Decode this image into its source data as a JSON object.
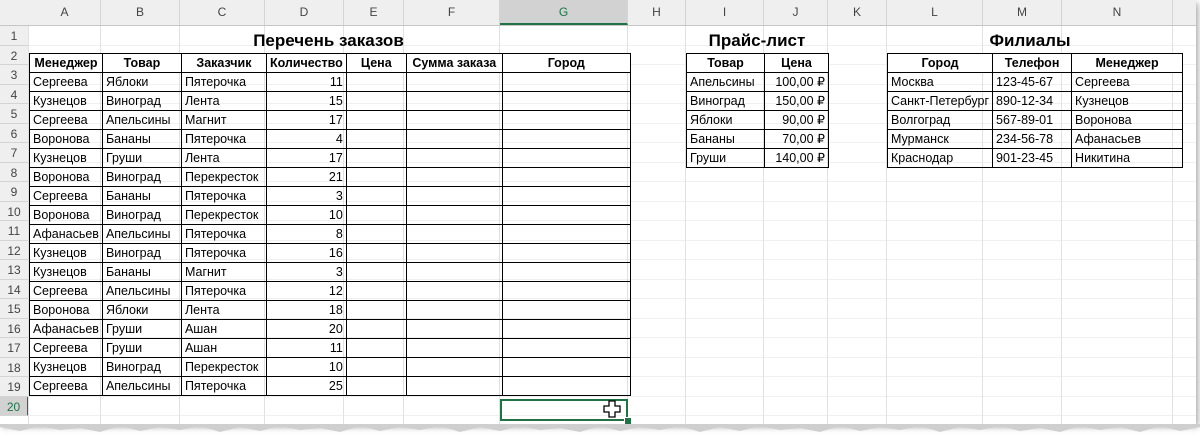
{
  "columns": [
    "A",
    "B",
    "C",
    "D",
    "E",
    "F",
    "G",
    "H",
    "I",
    "J",
    "K",
    "L",
    "M",
    "N"
  ],
  "rows": [
    "1",
    "2",
    "3",
    "4",
    "5",
    "6",
    "7",
    "8",
    "9",
    "10",
    "11",
    "12",
    "13",
    "14",
    "15",
    "16",
    "17",
    "18",
    "19",
    "20"
  ],
  "selected_column": "G",
  "selected_row": "20",
  "orders": {
    "title": "Перечень заказов",
    "headers": [
      "Менеджер",
      "Товар",
      "Заказчик",
      "Количество",
      "Цена",
      "Сумма заказа",
      "Город"
    ],
    "rows": [
      [
        "Сергеева",
        "Яблоки",
        "Пятерочка",
        "11"
      ],
      [
        "Кузнецов",
        "Виноград",
        "Лента",
        "15"
      ],
      [
        "Сергеева",
        "Апельсины",
        "Магнит",
        "17"
      ],
      [
        "Воронова",
        "Бананы",
        "Пятерочка",
        "4"
      ],
      [
        "Кузнецов",
        "Груши",
        "Лента",
        "17"
      ],
      [
        "Воронова",
        "Виноград",
        "Перекресток",
        "21"
      ],
      [
        "Сергеева",
        "Бананы",
        "Пятерочка",
        "3"
      ],
      [
        "Воронова",
        "Виноград",
        "Перекресток",
        "10"
      ],
      [
        "Афанасьев",
        "Апельсины",
        "Пятерочка",
        "8"
      ],
      [
        "Кузнецов",
        "Виноград",
        "Пятерочка",
        "16"
      ],
      [
        "Кузнецов",
        "Бананы",
        "Магнит",
        "3"
      ],
      [
        "Сергеева",
        "Апельсины",
        "Пятерочка",
        "12"
      ],
      [
        "Воронова",
        "Яблоки",
        "Лента",
        "18"
      ],
      [
        "Афанасьев",
        "Груши",
        "Ашан",
        "20"
      ],
      [
        "Сергеева",
        "Груши",
        "Ашан",
        "11"
      ],
      [
        "Кузнецов",
        "Виноград",
        "Перекресток",
        "10"
      ],
      [
        "Сергеева",
        "Апельсины",
        "Пятерочка",
        "25"
      ]
    ]
  },
  "pricelist": {
    "title": "Прайс-лист",
    "headers": [
      "Товар",
      "Цена"
    ],
    "rows": [
      [
        "Апельсины",
        "100,00 ₽"
      ],
      [
        "Виноград",
        "150,00 ₽"
      ],
      [
        "Яблоки",
        "90,00 ₽"
      ],
      [
        "Бананы",
        "70,00 ₽"
      ],
      [
        "Груши",
        "140,00 ₽"
      ]
    ]
  },
  "branches": {
    "title": "Филиалы",
    "headers": [
      "Город",
      "Телефон",
      "Менеджер"
    ],
    "rows": [
      [
        "Москва",
        "123-45-67",
        "Сергеева"
      ],
      [
        "Санкт-Петербург",
        "890-12-34",
        "Кузнецов"
      ],
      [
        "Волгоград",
        "567-89-01",
        "Воронова"
      ],
      [
        "Мурманск",
        "234-56-78",
        "Афанасьев"
      ],
      [
        "Краснодар",
        "901-23-45",
        "Никитина"
      ]
    ]
  },
  "colors": {
    "accent": "#217346",
    "gridline": "#e1e1e1",
    "header_bg": "#efefef"
  }
}
